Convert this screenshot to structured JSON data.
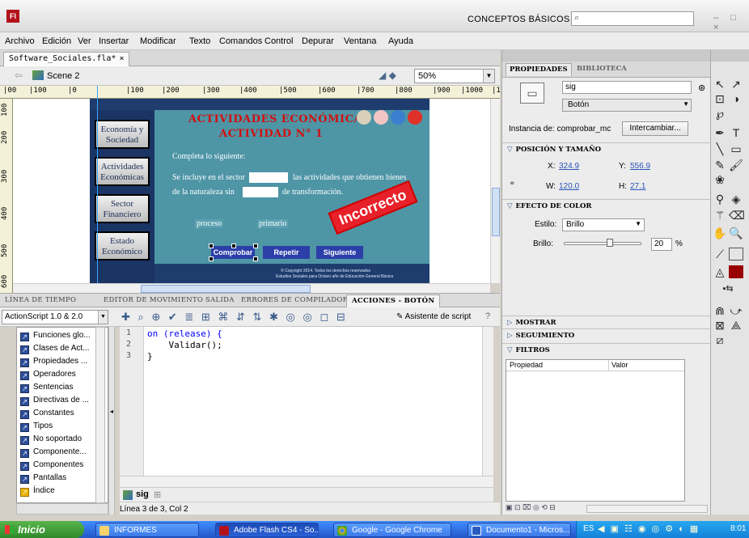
{
  "app": {
    "logo": "Fl",
    "workspace": "CONCEPTOS BÁSICOS",
    "search_placeholder": "",
    "window_controls": "– □ ×"
  },
  "menu": [
    "Archivo",
    "Edición",
    "Ver",
    "Insertar",
    "Modificar",
    "Texto",
    "Comandos",
    "Control",
    "Depurar",
    "Ventana",
    "Ayuda"
  ],
  "document": {
    "tab": "Software_Sociales.fla*",
    "close": "×",
    "scene": "Scene 2",
    "zoom": "50%"
  },
  "rulers": {
    "h": [
      "|00",
      "|100",
      "|0",
      "|100",
      "|200",
      "|300",
      "|400",
      "|500",
      "|600",
      "|700",
      "|800",
      "|900",
      "|1000",
      "|11"
    ],
    "v": [
      "100",
      "200",
      "300",
      "400",
      "500",
      "600"
    ]
  },
  "stage": {
    "nav": [
      "Economía y Sociedad",
      "Actividades Económicas",
      "Sector Financiero",
      "Estado Económico"
    ],
    "title1": "ACTIVIDADES ECONÓMICAS",
    "title2": "ACTIVIDAD N° 1",
    "instruction": "Completa lo siguiente:",
    "sentence1a": "Se incluye en el sector",
    "sentence1b": "las actividades que obtienen bienes",
    "sentence2a": "de la naturaleza sin",
    "sentence2b": "de transformación.",
    "option1": "proceso",
    "option2": "primario",
    "stamp": "Incorrecto",
    "buttons": [
      "Comprobar",
      "Repetir",
      "Siguiente"
    ],
    "copyright": "© Copyright 2014. Todos los derechos reservados",
    "footer": "Estudios Sociales para Octavo año de Educación General Básica"
  },
  "bottom_tabs": [
    "LÍNEA DE TIEMPO",
    "EDITOR DE MOVIMIENTO",
    "SALIDA",
    "ERRORES DE COMPILADOR",
    "ACCIONES - BOTÓN"
  ],
  "actions": {
    "version": "ActionScript 1.0 & 2.0",
    "assistant": "Asistente de script",
    "help": "?",
    "toolbox": [
      "Funciones glo...",
      "Clases de Act...",
      "Propiedades ...",
      "Operadores",
      "Sentencias",
      "Directivas de ...",
      "Constantes",
      "Tipos",
      "No soportado",
      "Componente...",
      "Componentes",
      "Pantallas",
      "Índice"
    ],
    "code_lines": [
      "on (release) {",
      "    Validar();",
      "}"
    ],
    "line_numbers": [
      "1",
      "2",
      "3"
    ],
    "symbol": "sig",
    "status": "Línea 3 de 3, Col 2"
  },
  "properties": {
    "tabs": [
      "PROPIEDADES",
      "BIBLIOTECA"
    ],
    "instance_name": "sig",
    "behavior": "Botón",
    "instance_of_label": "Instancia de:",
    "instance_of": "comprobar_mc",
    "swap": "Intercambiar...",
    "sec_pos": "POSICIÓN Y TAMAÑO",
    "x_label": "X:",
    "x": "324.9",
    "y_label": "Y:",
    "y": "556.9",
    "w_label": "W:",
    "w": "120.0",
    "h_label": "H:",
    "h": "27.1",
    "sec_color": "EFECTO DE COLOR",
    "style_label": "Estilo:",
    "style": "Brillo",
    "bright_label": "Brillo:",
    "bright": "20",
    "bright_fraction": 0.6,
    "pct": "%",
    "sec_show": "MOSTRAR",
    "sec_track": "SEGUIMIENTO",
    "sec_filters": "FILTROS",
    "col_prop": "Propiedad",
    "col_val": "Valor"
  },
  "taskbar": {
    "start": "Inicio",
    "items": [
      "INFORMES",
      "Adobe Flash CS4 - So...",
      "Google - Google Chrome",
      "Documento1 - Micros..."
    ],
    "lang": "ES",
    "clock": "8:01"
  }
}
